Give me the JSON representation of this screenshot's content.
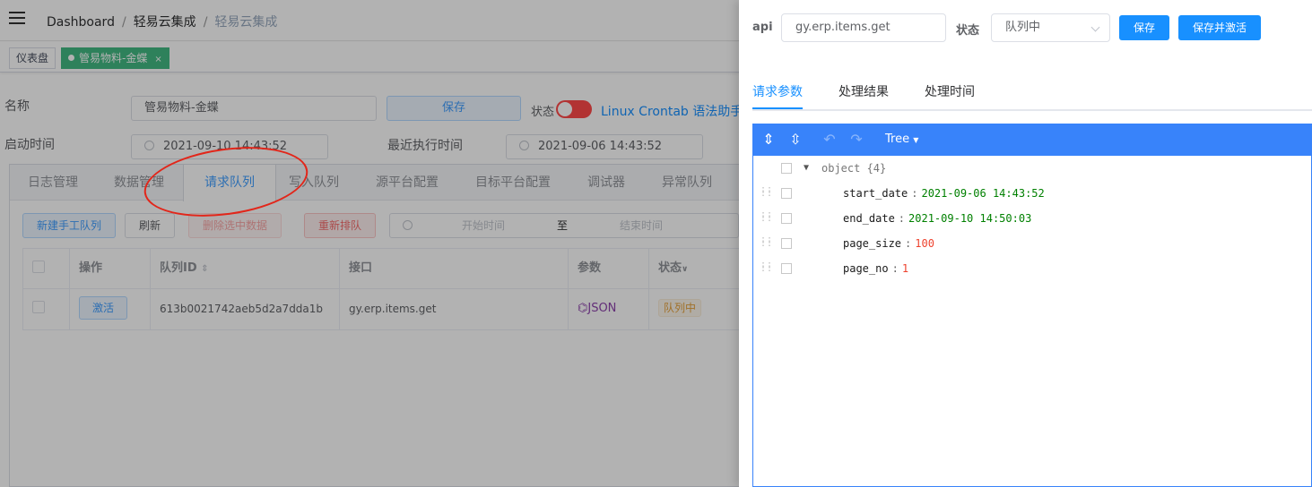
{
  "header": {
    "breadcrumb": [
      "Dashboard",
      "轻易云集成",
      "轻易云集成"
    ]
  },
  "tags": [
    {
      "label": "仪表盘",
      "active": false
    },
    {
      "label": "管易物料-金蝶",
      "active": true,
      "close": "×"
    }
  ],
  "form": {
    "name_label": "名称",
    "name_value": "管易物料-金蝶",
    "save_label": "保存",
    "status_label": "状态",
    "crontab_link": "Linux Crontab 语法助手",
    "start_label": "启动时间",
    "start_value": "2021-09-10 14:43:52",
    "last_label": "最近执行时间",
    "last_value": "2021-09-06 14:43:52"
  },
  "tabs": [
    "日志管理",
    "数据管理",
    "请求队列",
    "写入队列",
    "源平台配置",
    "目标平台配置",
    "调试器",
    "异常队列"
  ],
  "toolbar": {
    "new_queue": "新建手工队列",
    "refresh": "刷新",
    "delete_selected": "删除选中数据",
    "requeue": "重新排队",
    "start_placeholder": "开始时间",
    "range_sep": "至",
    "end_placeholder": "结束时间"
  },
  "table": {
    "headers": [
      "",
      "操作",
      "队列ID",
      "接口",
      "参数",
      "状态"
    ],
    "rows": [
      {
        "action": "激活",
        "id": "613b0021742aeb5d2a7dda1b",
        "api": "gy.erp.items.get",
        "param": "JSON",
        "status": "队列中"
      }
    ]
  },
  "drawer": {
    "api_label": "api",
    "api_value": "gy.erp.items.get",
    "status_label": "状态",
    "status_value": "队列中",
    "save": "保存",
    "save_activate": "保存并激活",
    "tabs": [
      "请求参数",
      "处理结果",
      "处理时间"
    ],
    "editor": {
      "mode": "Tree",
      "root": "object {4}",
      "fields": [
        {
          "key": "start_date",
          "value": "2021-09-06 14:43:52",
          "type": "string"
        },
        {
          "key": "end_date",
          "value": "2021-09-10 14:50:03",
          "type": "string"
        },
        {
          "key": "page_size",
          "value": "100",
          "type": "number"
        },
        {
          "key": "page_no",
          "value": "1",
          "type": "number"
        }
      ]
    }
  },
  "colors": {
    "primary": "#1890ff",
    "tag_active": "#42b983",
    "toggle_off": "#ff4949",
    "annotation": "#e2261a"
  }
}
